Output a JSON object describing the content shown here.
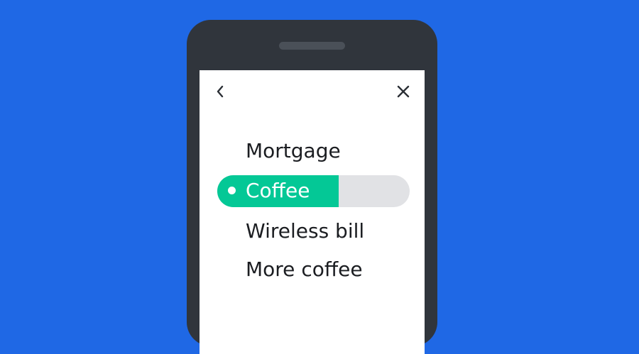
{
  "colors": {
    "background": "#1f68e5",
    "phone_body": "#30353c",
    "screen": "#ffffff",
    "accent": "#04c896",
    "track": "#e1e2e5",
    "text": "#1b1d21"
  },
  "header": {
    "back_icon": "chevron-left-icon",
    "close_icon": "close-icon"
  },
  "menu": {
    "items": [
      {
        "label": "Mortgage"
      },
      {
        "label": "Coffee",
        "selected": true,
        "progress_fraction": 0.63
      },
      {
        "label": "Wireless bill"
      },
      {
        "label": "More coffee"
      }
    ]
  }
}
